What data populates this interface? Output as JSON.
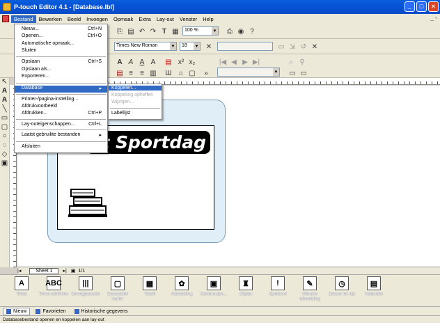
{
  "window": {
    "title": "P-touch Editor 4.1 - [Database.lbl]"
  },
  "menubar": {
    "items": [
      "Bestand",
      "Bewerken",
      "Beeld",
      "Invoegen",
      "Opmaak",
      "Extra",
      "Lay-out",
      "Venster",
      "Help"
    ]
  },
  "toolbar": {
    "font_name": "Times New Roman",
    "font_size": "18",
    "zoom": "100 %"
  },
  "file_menu": {
    "items": [
      {
        "label": "Nieuw...",
        "shortcut": "Ctrl+N"
      },
      {
        "label": "Openen...",
        "shortcut": "Ctrl+O"
      },
      {
        "label": "Automatische opmaak...",
        "shortcut": ""
      },
      {
        "label": "Sluiten",
        "shortcut": ""
      },
      {
        "label": "Opslaan",
        "shortcut": "Ctrl+S"
      },
      {
        "label": "Opslaan als...",
        "shortcut": ""
      },
      {
        "label": "Exporteren...",
        "shortcut": ""
      },
      {
        "label": "Database",
        "shortcut": ""
      },
      {
        "label": "Printer-/pagina-instelling...",
        "shortcut": ""
      },
      {
        "label": "Afdrukvoorbeeld",
        "shortcut": ""
      },
      {
        "label": "Afdrukken...",
        "shortcut": "Ctrl+P"
      },
      {
        "label": "Lay-outeigenschappen...",
        "shortcut": "Ctrl+L"
      },
      {
        "label": "Laatst gebruikte bestanden",
        "shortcut": ""
      },
      {
        "label": "Afsluiten",
        "shortcut": ""
      }
    ]
  },
  "database_submenu": {
    "items": [
      {
        "label": "Koppelen..."
      },
      {
        "label": "Koppeling opheffen"
      },
      {
        "label": "Wijzigen..."
      },
      {
        "label": "Labellijst"
      }
    ]
  },
  "label": {
    "title_text": "st Sportdag"
  },
  "sheet": {
    "tab": "Sheet 1",
    "page": "1/1"
  },
  "palette": {
    "items": [
      {
        "label": "Tekst",
        "icon": "A"
      },
      {
        "label": "Tekst schikken",
        "icon": "ABC"
      },
      {
        "label": "Streepjescode",
        "icon": "|||"
      },
      {
        "label": "Decoratief kader",
        "icon": "▢"
      },
      {
        "label": "Tabel",
        "icon": "▦"
      },
      {
        "label": "Afbeelding",
        "icon": "✿"
      },
      {
        "label": "Schermopn...",
        "icon": "▣"
      },
      {
        "label": "Clipart",
        "icon": "♜"
      },
      {
        "label": "Symbool",
        "icon": "!"
      },
      {
        "label": "Nieuwe afbeelding",
        "icon": "✎"
      },
      {
        "label": "Datum en tijd",
        "icon": "◷"
      },
      {
        "label": "Kalender",
        "icon": "▤"
      }
    ]
  },
  "bottom_tabs": [
    "Nieuw",
    "Favorieten",
    "Historische gegevens"
  ],
  "status": {
    "text": "Databasebestand openen en koppelen aan lay-out"
  }
}
